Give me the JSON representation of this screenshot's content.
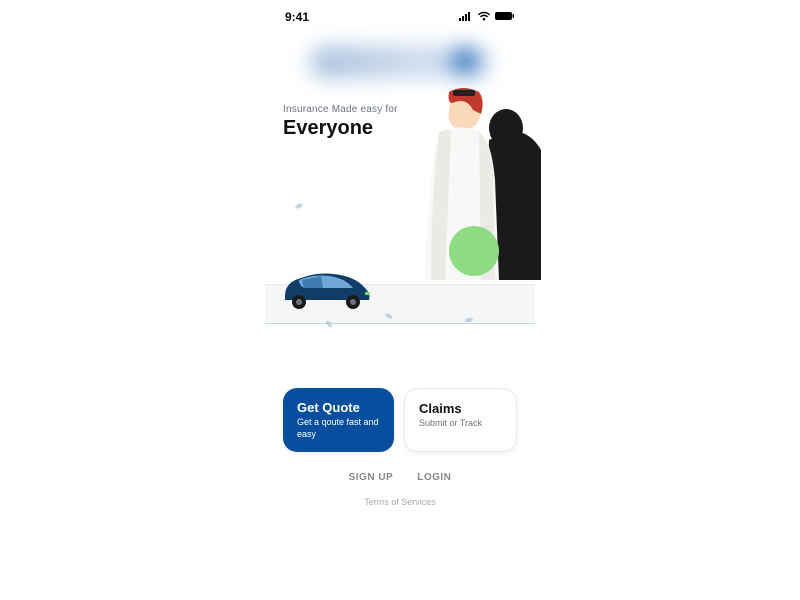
{
  "status": {
    "time": "9:41"
  },
  "hero": {
    "subtitle": "Insurance Made easy for",
    "title": "Everyone"
  },
  "cards": {
    "quote": {
      "title": "Get Quote",
      "sub": "Get a qoute fast and easy"
    },
    "claims": {
      "title": "Claims",
      "sub": "Submit or Track"
    }
  },
  "auth": {
    "signup": "SIGN UP",
    "login": "LOGIN"
  },
  "footer": {
    "tos": "Terms of Services"
  },
  "colors": {
    "primary": "#074f9e",
    "accent": "#8edc82"
  }
}
